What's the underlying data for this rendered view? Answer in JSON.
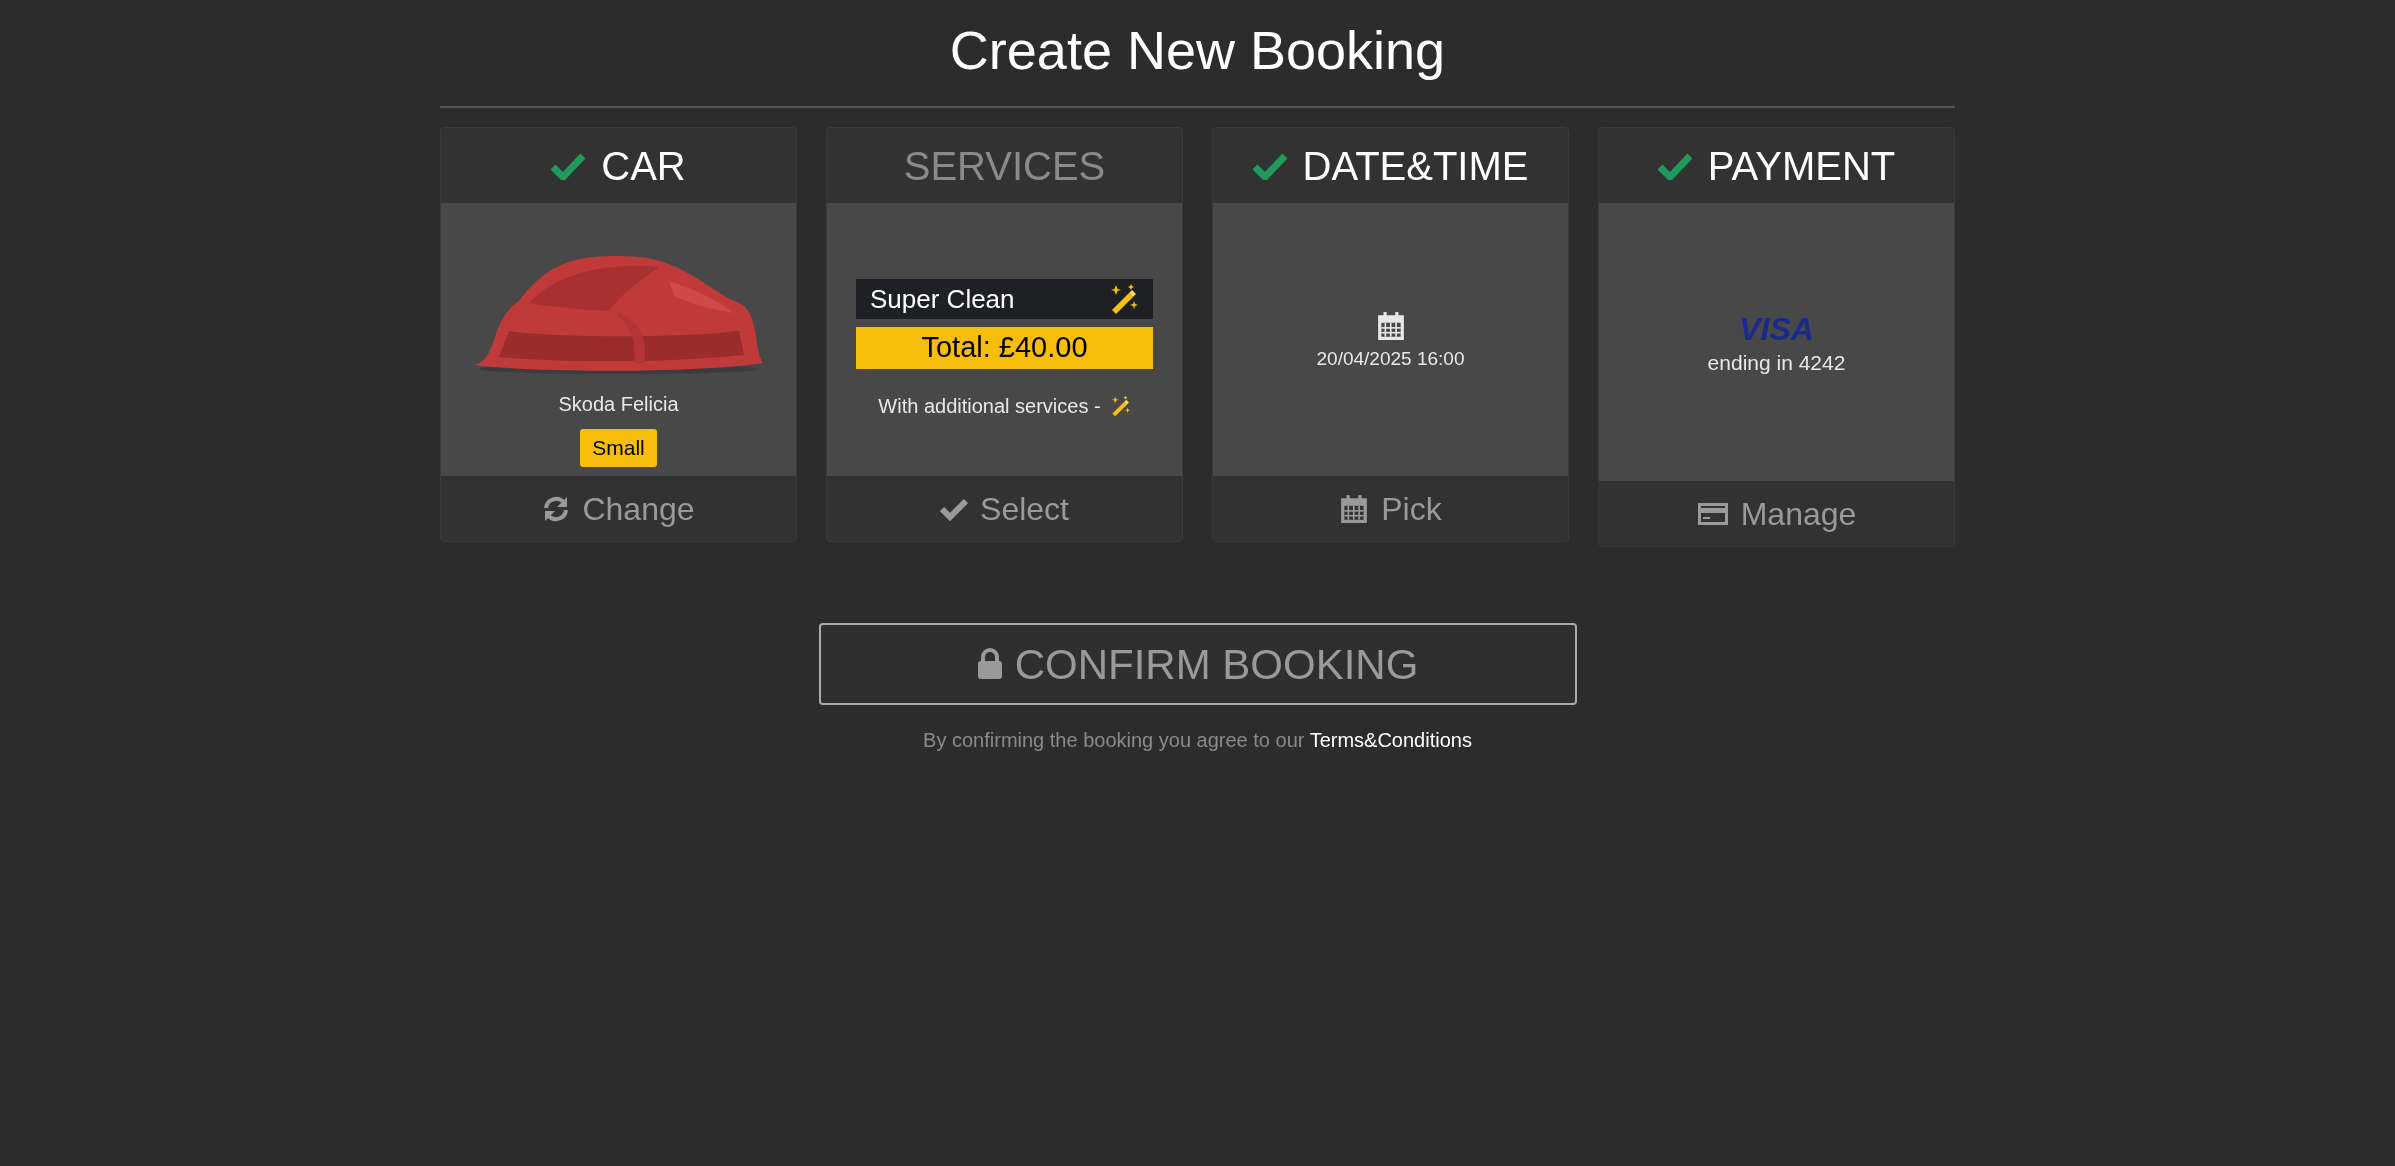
{
  "title": "Create New Booking",
  "steps": [
    {
      "kind": "car",
      "heading": "CAR",
      "done": true,
      "car_name": "Skoda Felicia",
      "size_badge": "Small",
      "action": "Change"
    },
    {
      "kind": "services",
      "heading": "SERVICES",
      "done": false,
      "service": "Super Clean",
      "total": "Total: £40.00",
      "note": "With additional services -",
      "action": "Select"
    },
    {
      "kind": "datetime",
      "heading": "DATE&TIME",
      "done": true,
      "datetime": "20/04/2025 16:00",
      "action": "Pick"
    },
    {
      "kind": "payment",
      "heading": "PAYMENT",
      "done": true,
      "card_brand": "VISA",
      "card_info": "ending in 4242",
      "action": "Manage"
    }
  ],
  "confirm_button": {
    "label": "CONFIRM BOOKING",
    "disabled": true
  },
  "terms": {
    "text": "By confirming the booking you agree to our",
    "link": "Terms&Conditions"
  }
}
